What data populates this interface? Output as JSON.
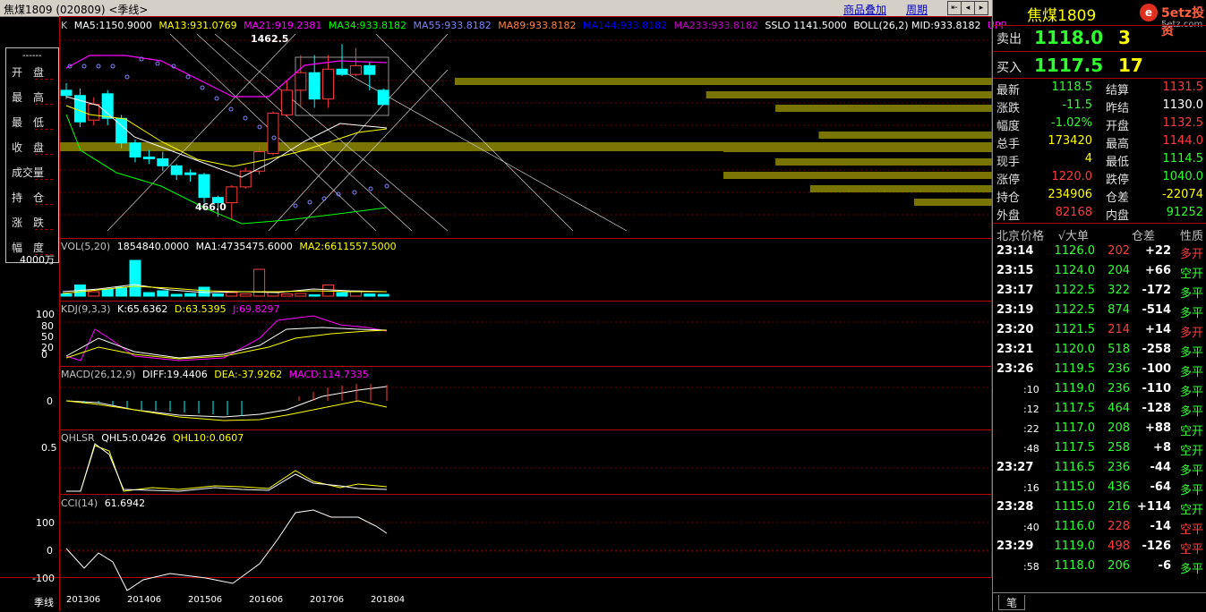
{
  "window": {
    "title": "焦煤1809 (020809) <季线>",
    "links": [
      "商品叠加",
      "周期"
    ]
  },
  "info_panel": {
    "header": "------",
    "items": [
      "开　盘",
      "最　高",
      "最　低",
      "收　盘",
      "成交量",
      "持　仓",
      "涨　跌",
      "幅　度"
    ]
  },
  "k_panel": {
    "label": "K",
    "indicators": [
      {
        "text": "MA5:1150.9000",
        "color": "#ffffff"
      },
      {
        "text": "MA13:931.0769",
        "color": "#ffff00"
      },
      {
        "text": "MA21:919.2381",
        "color": "#ff00ff"
      },
      {
        "text": "MA34:933.8182",
        "color": "#00ff00"
      },
      {
        "text": "MA55:933.8182",
        "color": "#8080ff"
      },
      {
        "text": "MA89:933.8182",
        "color": "#ff8040"
      },
      {
        "text": "MA144:933.8182",
        "color": "#0000ff"
      },
      {
        "text": "MA233:933.8182",
        "color": "#c000c0"
      },
      {
        "text": "SSLO 1141.5000",
        "color": "#ffffff"
      },
      {
        "text": "BOLL(26,2) MID:933.8182",
        "color": "#ffffff"
      },
      {
        "text": "UPP",
        "color": "#ff00ff"
      }
    ],
    "high_mark": "1462.5",
    "low_mark": "466.0"
  },
  "vol_panel": {
    "label": "VOL(5,20)",
    "values": [
      {
        "text": "1854840.0000",
        "color": "#ffffff"
      },
      {
        "text": "MA1:4735475.6000",
        "color": "#ffffff"
      },
      {
        "text": "MA2:6611557.5000",
        "color": "#ffff00"
      }
    ],
    "scale": "4000万"
  },
  "kdj_panel": {
    "label": "KDJ(9,3,3)",
    "values": [
      {
        "text": "K:65.6362",
        "color": "#ffffff"
      },
      {
        "text": "D:63.5395",
        "color": "#ffff00"
      },
      {
        "text": "J:69.8297",
        "color": "#ff00ff"
      }
    ],
    "axis": [
      "100",
      "80",
      "50",
      "20",
      "0"
    ]
  },
  "macd_panel": {
    "label": "MACD(26,12,9)",
    "values": [
      {
        "text": "DIFF:19.4406",
        "color": "#ffffff"
      },
      {
        "text": "DEA:-37.9262",
        "color": "#ffff00"
      },
      {
        "text": "MACD:114.7335",
        "color": "#ff00ff"
      }
    ],
    "axis": [
      "0"
    ]
  },
  "qhlsr_panel": {
    "label": "QHLSR",
    "values": [
      {
        "text": "QHL5:0.0426",
        "color": "#ffffff"
      },
      {
        "text": "QHL10:0.0607",
        "color": "#ffff00"
      }
    ],
    "axis": [
      "0.5"
    ]
  },
  "cci_panel": {
    "label": "CCI(14)",
    "values": [
      {
        "text": "61.6942",
        "color": "#ffffff"
      }
    ],
    "axis": [
      "100",
      "0",
      "-100"
    ]
  },
  "x_axis": {
    "period": "季线",
    "labels": [
      "201306",
      "201406",
      "201506",
      "201606",
      "201706",
      "201804"
    ]
  },
  "right_panel": {
    "symbol": "焦煤1809",
    "brand": "5etz投资",
    "brand_url": "5etz.com",
    "sell": {
      "label": "卖出",
      "price": "1118.0",
      "volume": "3"
    },
    "buy": {
      "label": "买入",
      "price": "1117.5",
      "volume": "17"
    },
    "quote": [
      {
        "l1": "最新",
        "v1": "1118.5",
        "c1": "green",
        "l2": "结算",
        "v2": "1131.5",
        "c2": "red"
      },
      {
        "l1": "涨跌",
        "v1": "-11.5",
        "c1": "green",
        "l2": "昨结",
        "v2": "1130.0",
        "c2": "white"
      },
      {
        "l1": "幅度",
        "v1": "-1.02%",
        "c1": "green",
        "l2": "开盘",
        "v2": "1132.5",
        "c2": "red"
      },
      {
        "l1": "总手",
        "v1": "173420",
        "c1": "yellow",
        "l2": "最高",
        "v2": "1144.0",
        "c2": "red"
      },
      {
        "l1": "现手",
        "v1": "4",
        "c1": "yellow",
        "l2": "最低",
        "v2": "1114.5",
        "c2": "green"
      },
      {
        "l1": "涨停",
        "v1": "1220.0",
        "c1": "red",
        "l2": "跌停",
        "v2": "1040.0",
        "c2": "green"
      },
      {
        "l1": "持仓",
        "v1": "234906",
        "c1": "yellow",
        "l2": "仓差",
        "v2": "-22074",
        "c2": "yellow"
      },
      {
        "l1": "外盘",
        "v1": "82168",
        "c1": "red",
        "l2": "内盘",
        "v2": "91252",
        "c2": "green"
      }
    ],
    "ticks_header": [
      "北京",
      "价格",
      "√大单",
      "仓差",
      "性质"
    ],
    "ticks": [
      {
        "time": "23:14",
        "price": "1126.0",
        "vol": "202",
        "vc": "red",
        "diff": "+22",
        "type": "多开",
        "tc": "red"
      },
      {
        "time": "23:15",
        "price": "1124.0",
        "vol": "204",
        "vc": "green",
        "diff": "+66",
        "type": "空开",
        "tc": "green"
      },
      {
        "time": "23:17",
        "price": "1122.5",
        "vol": "322",
        "vc": "green",
        "diff": "-172",
        "type": "多平",
        "tc": "green"
      },
      {
        "time": "23:19",
        "price": "1122.5",
        "vol": "874",
        "vc": "green",
        "diff": "-514",
        "type": "多平",
        "tc": "green"
      },
      {
        "time": "23:20",
        "price": "1121.5",
        "vol": "214",
        "vc": "red",
        "diff": "+14",
        "type": "多开",
        "tc": "red"
      },
      {
        "time": "23:21",
        "price": "1120.0",
        "vol": "518",
        "vc": "green",
        "diff": "-258",
        "type": "多平",
        "tc": "green"
      },
      {
        "time": "23:26",
        "price": "1119.5",
        "vol": "236",
        "vc": "green",
        "diff": "-100",
        "type": "多平",
        "tc": "green"
      },
      {
        "time": ":10",
        "price": "1119.0",
        "vol": "236",
        "vc": "green",
        "diff": "-110",
        "type": "多平",
        "tc": "green"
      },
      {
        "time": ":12",
        "price": "1117.5",
        "vol": "464",
        "vc": "green",
        "diff": "-128",
        "type": "多平",
        "tc": "green"
      },
      {
        "time": ":22",
        "price": "1117.0",
        "vol": "208",
        "vc": "green",
        "diff": "+88",
        "type": "空开",
        "tc": "green"
      },
      {
        "time": ":48",
        "price": "1117.5",
        "vol": "258",
        "vc": "green",
        "diff": "+8",
        "type": "空开",
        "tc": "green"
      },
      {
        "time": "23:27",
        "price": "1116.5",
        "vol": "236",
        "vc": "green",
        "diff": "-44",
        "type": "多平",
        "tc": "green"
      },
      {
        "time": ":16",
        "price": "1115.0",
        "vol": "436",
        "vc": "green",
        "diff": "-64",
        "type": "多平",
        "tc": "green"
      },
      {
        "time": "23:28",
        "price": "1115.0",
        "vol": "216",
        "vc": "green",
        "diff": "+114",
        "type": "空开",
        "tc": "green"
      },
      {
        "time": ":40",
        "price": "1116.0",
        "vol": "228",
        "vc": "red",
        "diff": "-14",
        "type": "空平",
        "tc": "red"
      },
      {
        "time": "23:29",
        "price": "1119.0",
        "vol": "498",
        "vc": "red",
        "diff": "-126",
        "type": "空平",
        "tc": "red"
      },
      {
        "time": ":58",
        "price": "1118.0",
        "vol": "206",
        "vc": "green",
        "diff": "-6",
        "type": "多平",
        "tc": "green"
      }
    ],
    "bottom_tab": "笔"
  },
  "chart_data": {
    "type": "candlestick",
    "title": "焦煤1809 (020809) <季线>",
    "x_labels": [
      "201306",
      "201406",
      "201506",
      "201606",
      "201706",
      "201804"
    ],
    "high": 1462.5,
    "low": 466.0,
    "candles": [
      {
        "o": 1200,
        "c": 1170,
        "h": 1240,
        "l": 1150
      },
      {
        "o": 1170,
        "c": 1020,
        "h": 1210,
        "l": 990
      },
      {
        "o": 1030,
        "c": 1120,
        "h": 1160,
        "l": 1000
      },
      {
        "o": 1180,
        "c": 1040,
        "h": 1200,
        "l": 1000
      },
      {
        "o": 1040,
        "c": 900,
        "h": 1060,
        "l": 870
      },
      {
        "o": 900,
        "c": 820,
        "h": 920,
        "l": 790
      },
      {
        "o": 820,
        "c": 810,
        "h": 860,
        "l": 780
      },
      {
        "o": 810,
        "c": 770,
        "h": 850,
        "l": 740
      },
      {
        "o": 770,
        "c": 720,
        "h": 780,
        "l": 690
      },
      {
        "o": 730,
        "c": 720,
        "h": 750,
        "l": 680
      },
      {
        "o": 720,
        "c": 590,
        "h": 730,
        "l": 560
      },
      {
        "o": 590,
        "c": 560,
        "h": 600,
        "l": 480
      },
      {
        "o": 560,
        "c": 650,
        "h": 660,
        "l": 466
      },
      {
        "o": 650,
        "c": 740,
        "h": 760,
        "l": 640
      },
      {
        "o": 740,
        "c": 850,
        "h": 880,
        "l": 720
      },
      {
        "o": 840,
        "c": 1070,
        "h": 1080,
        "l": 830
      },
      {
        "o": 1060,
        "c": 1200,
        "h": 1250,
        "l": 1050
      },
      {
        "o": 1200,
        "c": 1300,
        "h": 1400,
        "l": 1100
      },
      {
        "o": 1300,
        "c": 1150,
        "h": 1400,
        "l": 1100
      },
      {
        "o": 1150,
        "c": 1320,
        "h": 1400,
        "l": 1100
      },
      {
        "o": 1320,
        "c": 1290,
        "h": 1462.5,
        "l": 1280
      },
      {
        "o": 1290,
        "c": 1340,
        "h": 1440,
        "l": 1280
      },
      {
        "o": 1340,
        "c": 1290,
        "h": 1360,
        "l": 1200
      },
      {
        "o": 1200,
        "c": 1118.5,
        "h": 1210,
        "l": 1114.5
      }
    ],
    "volume": [
      5,
      25,
      10,
      15,
      20,
      80,
      8,
      12,
      4,
      6,
      20,
      5,
      8,
      5,
      60,
      10,
      5,
      6,
      3,
      25,
      8,
      10,
      5,
      4
    ],
    "volume_profile": [
      62,
      33,
      25,
      20,
      31,
      25,
      31,
      21,
      9
    ]
  }
}
